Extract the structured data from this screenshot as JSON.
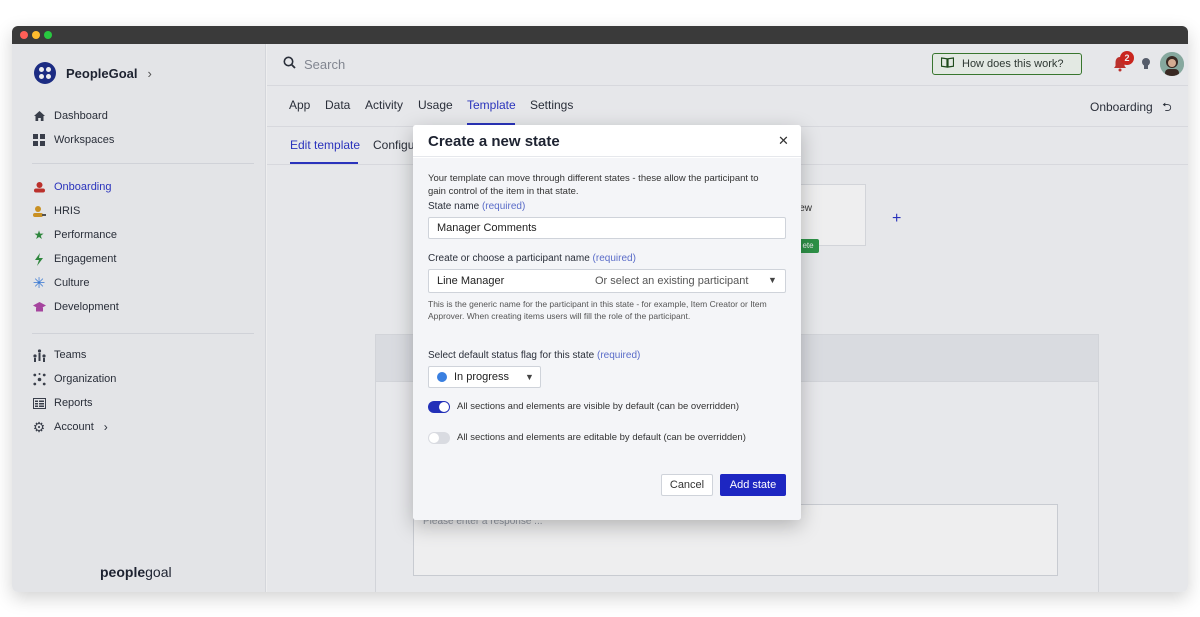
{
  "app": {
    "name": "PeopleGoal",
    "footer_logo_strong": "people",
    "footer_logo_light": "goal"
  },
  "sidebar": {
    "items_top": [
      {
        "label": "Dashboard",
        "icon": "home-icon"
      },
      {
        "label": "Workspaces",
        "icon": "grid-icon"
      }
    ],
    "items_modules": [
      {
        "label": "Onboarding",
        "icon": "onboarding-icon",
        "active": true,
        "color": "#2b35c8"
      },
      {
        "label": "HRIS",
        "icon": "person-icon",
        "color": "#d79a22"
      },
      {
        "label": "Performance",
        "icon": "star-icon",
        "color": "#2f8f3e"
      },
      {
        "label": "Engagement",
        "icon": "lightning-icon",
        "color": "#2f8f3e"
      },
      {
        "label": "Culture",
        "icon": "asterisk-icon",
        "color": "#3a7fe0"
      },
      {
        "label": "Development",
        "icon": "graduation-cap-icon",
        "color": "#b047a8"
      }
    ],
    "items_bottom": [
      {
        "label": "Teams",
        "icon": "teams-icon"
      },
      {
        "label": "Organization",
        "icon": "organization-icon"
      },
      {
        "label": "Reports",
        "icon": "reports-icon"
      },
      {
        "label": "Account",
        "icon": "gear-icon"
      }
    ]
  },
  "topbar": {
    "search_placeholder": "Search",
    "help_label": "How does this work?",
    "notification_count": "2"
  },
  "tabs": [
    "App",
    "Data",
    "Activity",
    "Usage",
    "Template",
    "Settings"
  ],
  "active_tab": "Template",
  "breadcrumb_right": "Onboarding",
  "subtabs": {
    "edit": "Edit template",
    "config": "Configu"
  },
  "background_card": {
    "text": "iew",
    "tag": "ete"
  },
  "textarea_placeholder": "Please enter a response ...",
  "modal": {
    "title": "Create a new state",
    "description": "Your template can move through different states - these allow the participant to gain control of the item in that state.",
    "state_name_label": "State name",
    "required": "(required)",
    "state_name_value": "Manager Comments",
    "participant_label": "Create or choose a participant name",
    "participant_value": "Line Manager",
    "participant_select": "Or select an existing participant",
    "participant_hint": "This is the generic name for the participant in this state - for example, Item Creator or Item Approver. When creating items users will fill the role of the participant.",
    "status_label": "Select default status flag for this state",
    "status_value": "In progress",
    "status_color": "#3a7fe0",
    "toggle_visible_label": "All sections and elements are visible by default (can be overridden)",
    "toggle_visible_on": true,
    "toggle_editable_label": "All sections and elements are editable by default (can be overridden)",
    "toggle_editable_on": false,
    "cancel_label": "Cancel",
    "add_label": "Add state"
  }
}
